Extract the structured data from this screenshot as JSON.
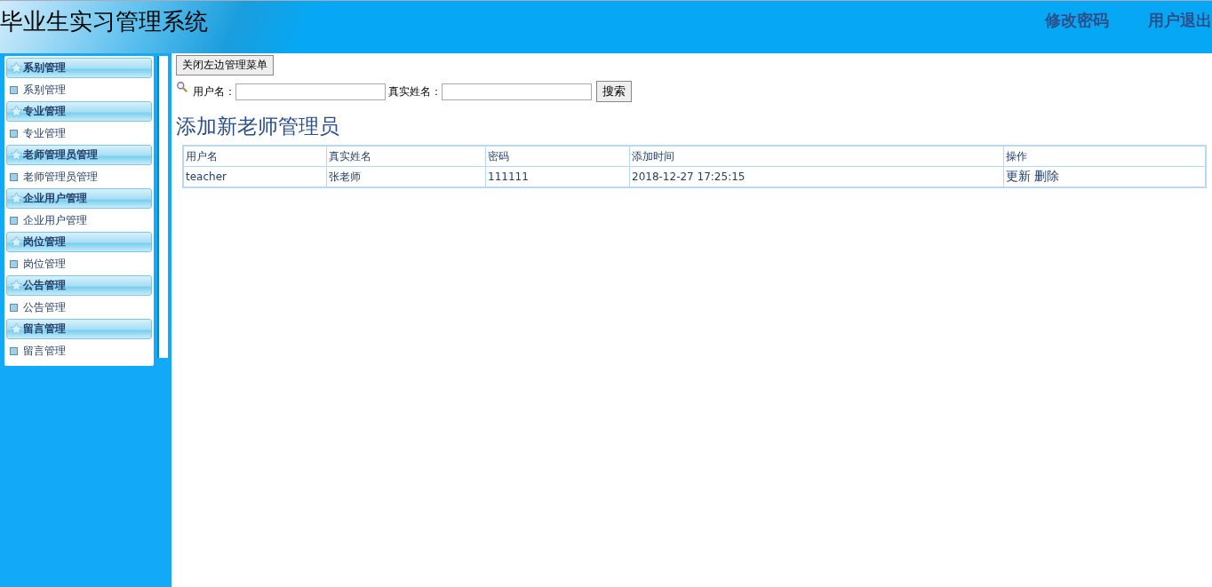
{
  "header": {
    "title": "毕业生实习管理系统",
    "links": [
      "修改密码",
      "用户退出"
    ]
  },
  "sidebar": {
    "groups": [
      {
        "title": "系别管理",
        "items": [
          "系别管理"
        ]
      },
      {
        "title": "专业管理",
        "items": [
          "专业管理"
        ]
      },
      {
        "title": "老师管理员管理",
        "items": [
          "老师管理员管理"
        ]
      },
      {
        "title": "企业用户管理",
        "items": [
          "企业用户管理"
        ]
      },
      {
        "title": "岗位管理",
        "items": [
          "岗位管理"
        ]
      },
      {
        "title": "公告管理",
        "items": [
          "公告管理"
        ]
      },
      {
        "title": "留言管理",
        "items": [
          "留言管理"
        ]
      }
    ]
  },
  "toggle_button": "关闭左边管理菜单",
  "search": {
    "fields": [
      {
        "label": "用户名："
      },
      {
        "label": "真实姓名："
      }
    ],
    "button": "搜索"
  },
  "add_link": "添加新老师管理员",
  "table": {
    "columns": [
      "用户名",
      "真实姓名",
      "密码",
      "添加时间",
      "操作"
    ],
    "rows": [
      {
        "cells": [
          "teacher",
          "张老师",
          "111111",
          "2018-12-27 17:25:15"
        ],
        "actions": [
          "更新",
          "删除"
        ]
      }
    ]
  }
}
